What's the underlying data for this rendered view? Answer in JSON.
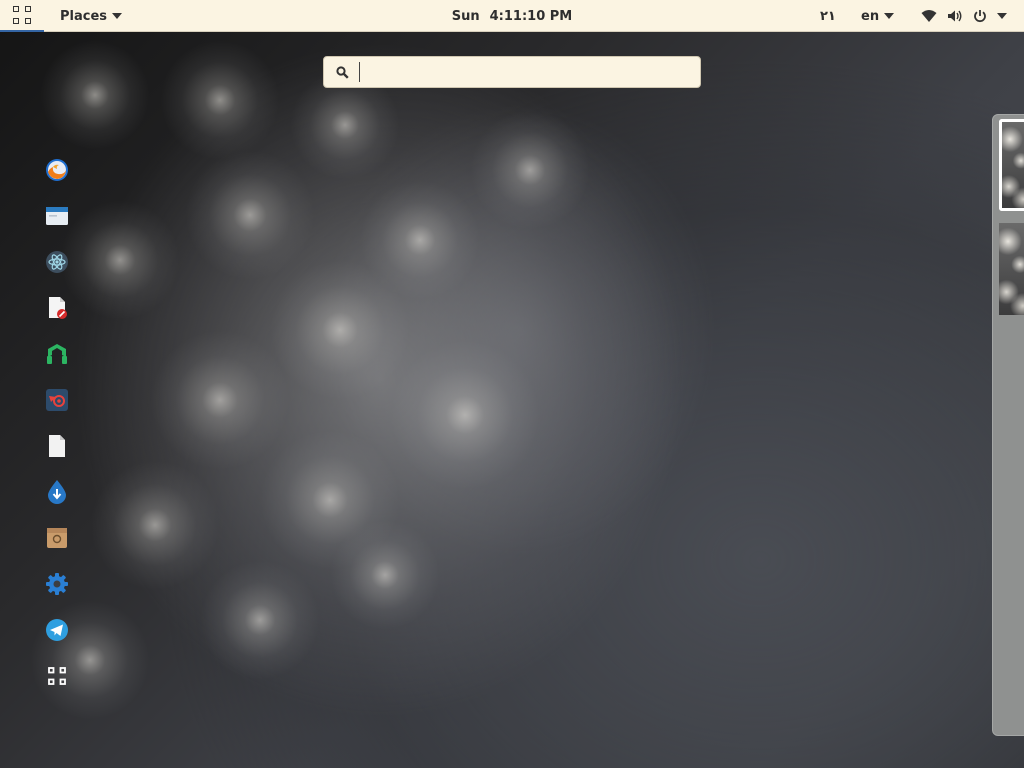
{
  "topbar": {
    "activities_icon": "show-apps-grid-icon",
    "places_label": "Places",
    "clock_day": "Sun",
    "clock_time": "4:11:10 PM",
    "workspace_indicator": "۲۱",
    "language_label": "en",
    "status_icons": [
      "wifi-icon",
      "volume-icon",
      "power-icon",
      "chevron-down-icon"
    ]
  },
  "search": {
    "placeholder": "",
    "value": "",
    "icon": "search-icon"
  },
  "dash": {
    "items": [
      {
        "name": "firefox",
        "icon": "firefox-icon"
      },
      {
        "name": "files",
        "icon": "files-icon"
      },
      {
        "name": "atom",
        "icon": "atom-icon"
      },
      {
        "name": "document-viewer",
        "icon": "document-viewer-icon"
      },
      {
        "name": "headset-app",
        "icon": "headset-icon"
      },
      {
        "name": "blender",
        "icon": "blender-icon"
      },
      {
        "name": "text-document",
        "icon": "text-document-icon"
      },
      {
        "name": "download-manager",
        "icon": "download-drop-icon"
      },
      {
        "name": "archive-manager",
        "icon": "archive-icon"
      },
      {
        "name": "settings",
        "icon": "gear-icon"
      },
      {
        "name": "telegram",
        "icon": "telegram-icon"
      },
      {
        "name": "show-applications",
        "icon": "show-apps-grid-icon"
      }
    ]
  },
  "workspaces": {
    "count": 2,
    "active_index": 0
  },
  "colors": {
    "topbar_bg": "#fbf4e2",
    "activities_underline": "#3465a4",
    "workspace_strip_bg": "#8f9190"
  }
}
